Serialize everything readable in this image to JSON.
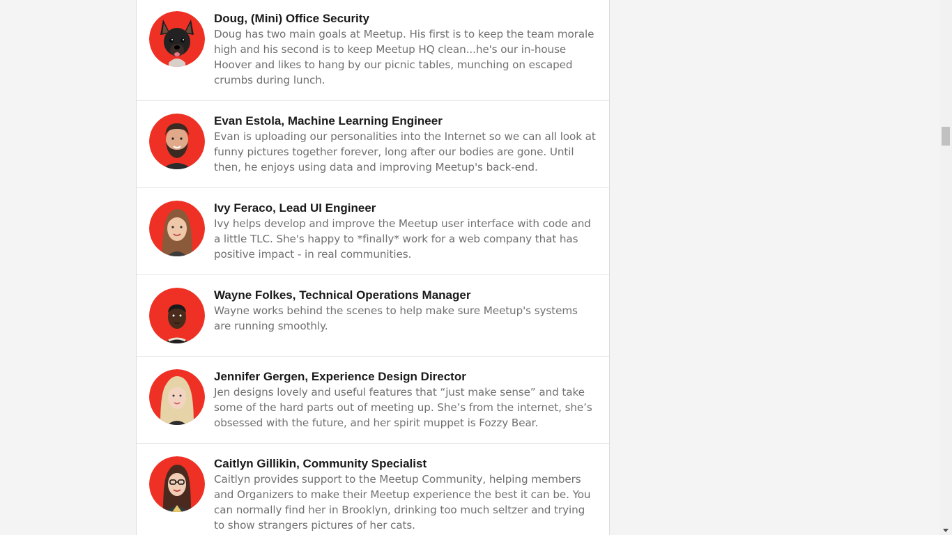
{
  "team": [
    {
      "name": "Doug, (Mini) Office Security",
      "bio": "Doug has two main goals at Meetup. His first is to keep the team morale high and his second is to keep Meetup HQ clean...he's our in-house Hoover and likes to hang by our picnic tables, munching on escaped crumbs during lunch."
    },
    {
      "name": "Evan Estola, Machine Learning Engineer",
      "bio": "Evan is uploading our personalities into the Internet so we can all look at funny pictures together forever, long after our bodies are gone. Until then, he enjoys using data and improving Meetup's back-end."
    },
    {
      "name": "Ivy Feraco, Lead UI Engineer",
      "bio": "Ivy helps develop and improve the Meetup user interface with code and a little TLC. She's happy to *finally* work for a web company that has positive impact - in real communities."
    },
    {
      "name": "Wayne Folkes, Technical Operations Manager",
      "bio": "Wayne works behind the scenes to help make sure Meetup's systems are running smoothly."
    },
    {
      "name": "Jennifer Gergen, Experience Design Director",
      "bio": "Jen designs lovely and useful features that “just make sense” and take some of the hard parts out of meeting up. She’s from the internet, she’s obsessed with the future, and her spirit muppet is Fozzy Bear."
    },
    {
      "name": "Caitlyn Gillikin, Community Specialist",
      "bio": "Caitlyn provides support to the Meetup Community, helping members and Organizers to make their Meetup experience the best it can be. You can normally find her in Brooklyn, drinking too much seltzer and trying to show strangers pictures of her cats."
    }
  ],
  "colors": {
    "avatar_background": "#ee3124",
    "page_background": "#f4f4f4",
    "card_background": "#ffffff",
    "name_text": "#1a1a1a",
    "bio_text": "#707070"
  }
}
